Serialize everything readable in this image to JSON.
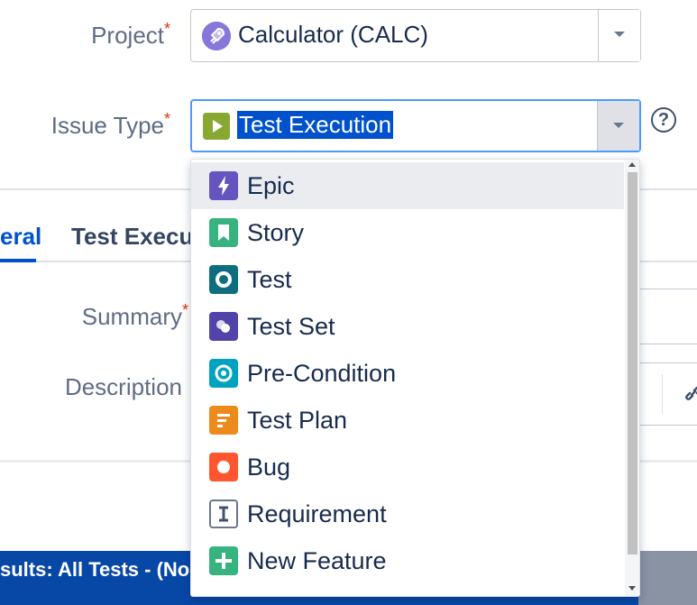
{
  "form": {
    "project": {
      "label": "Project",
      "required_mark": "*",
      "value": "Calculator (CALC)",
      "icon": "rocket-avatar-icon"
    },
    "issue_type": {
      "label": "Issue Type",
      "required_mark": "*",
      "value": "Test Execution",
      "icon": "test-execution-icon"
    },
    "summary": {
      "label": "Summary",
      "required_mark": "*"
    },
    "description": {
      "label": "Description"
    }
  },
  "tabs": [
    {
      "label": "eral"
    },
    {
      "label": "Test Executi"
    }
  ],
  "dropdown": {
    "items": [
      {
        "label": "Epic",
        "icon": "epic-icon",
        "color": "#6554c0"
      },
      {
        "label": "Story",
        "icon": "story-icon",
        "color": "#36b37e"
      },
      {
        "label": "Test",
        "icon": "test-icon",
        "color": "#0e6e7f"
      },
      {
        "label": "Test Set",
        "icon": "test-set-icon",
        "color": "#5243aa"
      },
      {
        "label": "Pre-Condition",
        "icon": "pre-condition-icon",
        "color": "#00a3bf"
      },
      {
        "label": "Test Plan",
        "icon": "test-plan-icon",
        "color": "#ec8b1c"
      },
      {
        "label": "Bug",
        "icon": "bug-icon",
        "color": "#ff5630"
      },
      {
        "label": "Requirement",
        "icon": "requirement-icon",
        "color": "#6b778c"
      },
      {
        "label": "New Feature",
        "icon": "new-feature-icon",
        "color": "#36b37e"
      }
    ]
  },
  "background": {
    "results_banner": "sults: All Tests - (No"
  },
  "colors": {
    "accent": "#0052cc",
    "selection": "#0052cc",
    "banner": "#0747a6"
  }
}
